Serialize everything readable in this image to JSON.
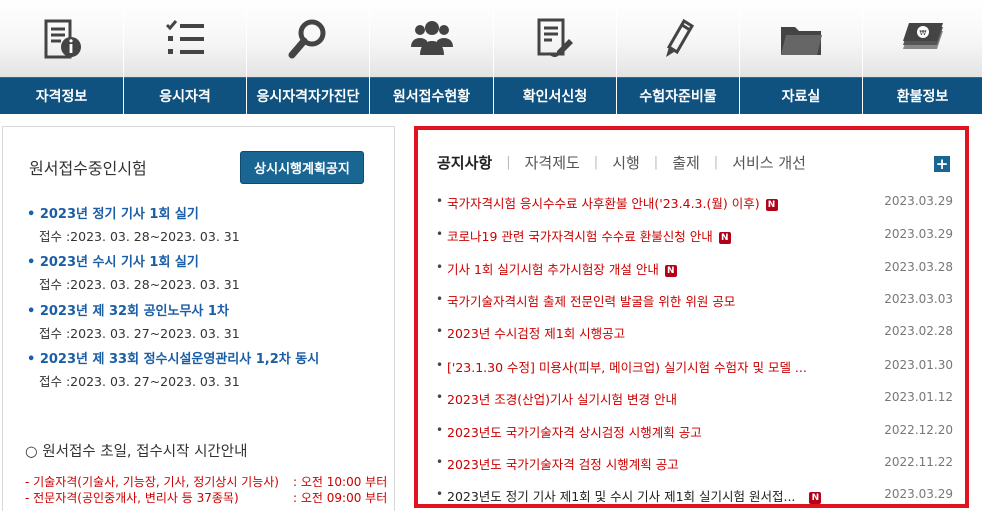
{
  "menu": [
    {
      "label": "자격정보",
      "icon": "document-info-icon"
    },
    {
      "label": "응시자격",
      "icon": "checklist-icon"
    },
    {
      "label": "응시자격자가진단",
      "icon": "magnifier-icon"
    },
    {
      "label": "원서접수현황",
      "icon": "people-group-icon"
    },
    {
      "label": "확인서신청",
      "icon": "document-edit-icon"
    },
    {
      "label": "수험자준비물",
      "icon": "pencil-icon"
    },
    {
      "label": "자료실",
      "icon": "folder-icon"
    },
    {
      "label": "환불정보",
      "icon": "money-stack-icon"
    }
  ],
  "left": {
    "title": "원서접수중인시험",
    "notice_button": "상시시행계획공지",
    "exams": [
      {
        "name": "2023년 정기 기사 1회 실기",
        "period": "접수 :2023. 03. 28~2023. 03. 31"
      },
      {
        "name": "2023년 수시 기사 1회 실기",
        "period": "접수 :2023. 03. 28~2023. 03. 31"
      },
      {
        "name": "2023년 제 32회 공인노무사 1차",
        "period": "접수 :2023. 03. 27~2023. 03. 31"
      },
      {
        "name": "2023년 제 33회 정수시설운영관리사 1,2차 동시",
        "period": "접수 :2023. 03. 27~2023. 03. 31"
      }
    ],
    "guide_title": "○ 원서접수 초일, 접수시작 시간안내",
    "guide_lines": [
      {
        "text": "- 기술자격(기술사, 기능장, 기사, 정기상시 기능사)",
        "time": ": 오전 10:00 부터"
      },
      {
        "text": "- 전문자격(공인중개사, 변리사 등 37종목)",
        "time": ": 오전 09:00 부터"
      }
    ]
  },
  "notices": {
    "tabs": [
      "공지사항",
      "자격제도",
      "시행",
      "출제",
      "서비스 개선"
    ],
    "tab_separator": "|",
    "plus_label": "+",
    "new_badge": "N",
    "items": [
      {
        "title": "국가자격시험 응시수수료 사후환불 안내('23.4.3.(월) 이후)",
        "date": "2023.03.29",
        "new": true,
        "color": "#cc0000"
      },
      {
        "title": "코로나19 관련 국가자격시험 수수료 환불신청 안내",
        "date": "2023.03.29",
        "new": true,
        "color": "#cc0000"
      },
      {
        "title": "기사 1회 실기시험 추가시험장 개설 안내",
        "date": "2023.03.28",
        "new": true,
        "color": "#cc0000"
      },
      {
        "title": "국가기술자격시험 출제 전문인력 발굴을 위한 위원 공모",
        "date": "2023.03.03",
        "new": false,
        "color": "#cc0000"
      },
      {
        "title": "2023년 수시검정 제1회 시행공고",
        "date": "2023.02.28",
        "new": false,
        "color": "#cc0000"
      },
      {
        "title": "['23.1.30 수정] 미용사(피부, 메이크업) 실기시험 수험자 및 모델 ...",
        "date": "2023.01.30",
        "new": false,
        "color": "#cc0000"
      },
      {
        "title": "2023년 조경(산업)기사 실기시험 변경 안내",
        "date": "2023.01.12",
        "new": false,
        "color": "#cc0000"
      },
      {
        "title": "2023년도 국가기술자격 상시검정 시행계획 공고",
        "date": "2022.12.20",
        "new": false,
        "color": "#cc0000"
      },
      {
        "title": "2023년도 국가기술자격 검정 시행계획 공고",
        "date": "2022.11.22",
        "new": false,
        "color": "#cc0000"
      },
      {
        "title": "2023년도 정기 기사 제1회 및 수시 기사 제1회 실기시험 원서접...",
        "date": "2023.03.29",
        "new": true,
        "color": "#222222"
      }
    ]
  },
  "colors": {
    "nav_blue": "#0f5280",
    "accent_red": "#e0141e",
    "link_blue": "#1a5ea6"
  }
}
